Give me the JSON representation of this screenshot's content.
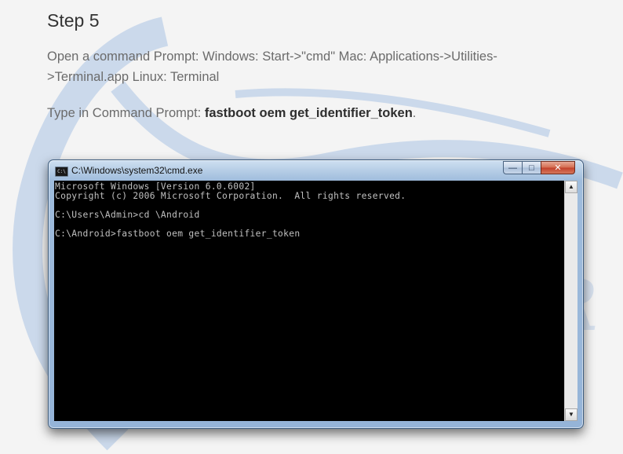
{
  "step": {
    "title": "Step 5"
  },
  "instructions": {
    "line1": "Open a command Prompt: Windows: Start->\"cmd\" Mac: Applications->Utilities->Terminal.app Linux: Terminal",
    "line2_prefix": "Type in Command Prompt: ",
    "line2_command": "fastboot oem get_identifier_token",
    "line2_suffix": "."
  },
  "window": {
    "title": "C:\\Windows\\system32\\cmd.exe",
    "icon_label": "C:\\",
    "controls": {
      "minimize": "—",
      "maximize": "□",
      "close": "✕"
    }
  },
  "console": {
    "lines": [
      "Microsoft Windows [Version 6.0.6002]",
      "Copyright (c) 2006 Microsoft Corporation.  All rights reserved.",
      "C:\\Users\\Admin>cd \\Android",
      "C:\\Android>fastboot oem get_identifier_token"
    ]
  },
  "scrollbar": {
    "up": "▲",
    "down": "▼"
  },
  "colors": {
    "console_bg": "#000000",
    "console_text": "#c0c0c0",
    "frame": "#95b4d8"
  }
}
